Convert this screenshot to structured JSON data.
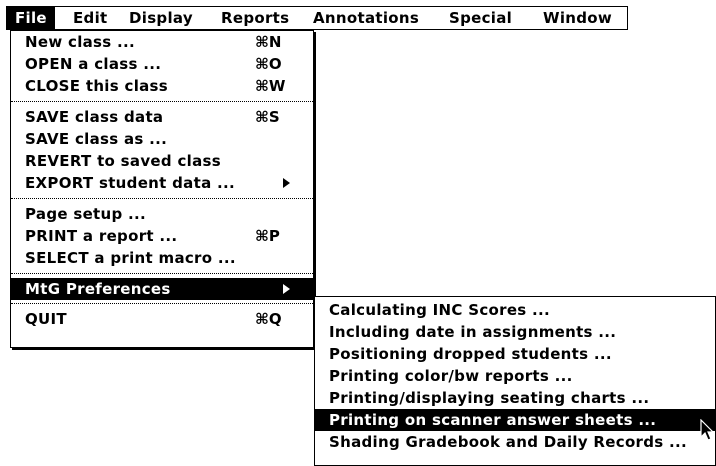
{
  "menubar": {
    "items": [
      {
        "label": "File",
        "active": true
      },
      {
        "label": "Edit"
      },
      {
        "label": "Display"
      },
      {
        "label": "Reports"
      },
      {
        "label": "Annotations"
      },
      {
        "label": "Special"
      },
      {
        "label": "Window"
      }
    ]
  },
  "file_menu": {
    "groups": [
      [
        {
          "label": "New class ...",
          "shortcut": "⌘N"
        },
        {
          "label": "OPEN a class ...",
          "shortcut": "⌘O"
        },
        {
          "label": "CLOSE this class",
          "shortcut": "⌘W"
        }
      ],
      [
        {
          "label": "SAVE class data",
          "shortcut": "⌘S"
        },
        {
          "label": "SAVE class as ...",
          "shortcut": ""
        },
        {
          "label": "REVERT to saved class",
          "shortcut": ""
        },
        {
          "label": "EXPORT student data ...",
          "shortcut": "",
          "submenu": true
        }
      ],
      [
        {
          "label": "Page setup ...",
          "shortcut": ""
        },
        {
          "label": "PRINT a report ...",
          "shortcut": "⌘P"
        },
        {
          "label": "SELECT a print macro ...",
          "shortcut": ""
        }
      ],
      [
        {
          "label": "MtG Preferences",
          "shortcut": "",
          "submenu": true,
          "highlighted": true
        }
      ],
      [
        {
          "label": "QUIT",
          "shortcut": "⌘Q"
        }
      ]
    ]
  },
  "preferences_submenu": {
    "items": [
      {
        "label": "Calculating INC Scores ..."
      },
      {
        "label": "Including date in assignments ..."
      },
      {
        "label": "Positioning dropped students ..."
      },
      {
        "label": "Printing color/bw reports ..."
      },
      {
        "label": "Printing/displaying seating charts ..."
      },
      {
        "label": "Printing on scanner answer sheets ...",
        "highlighted": true
      },
      {
        "label": "Shading Gradebook and Daily Records ..."
      }
    ]
  }
}
